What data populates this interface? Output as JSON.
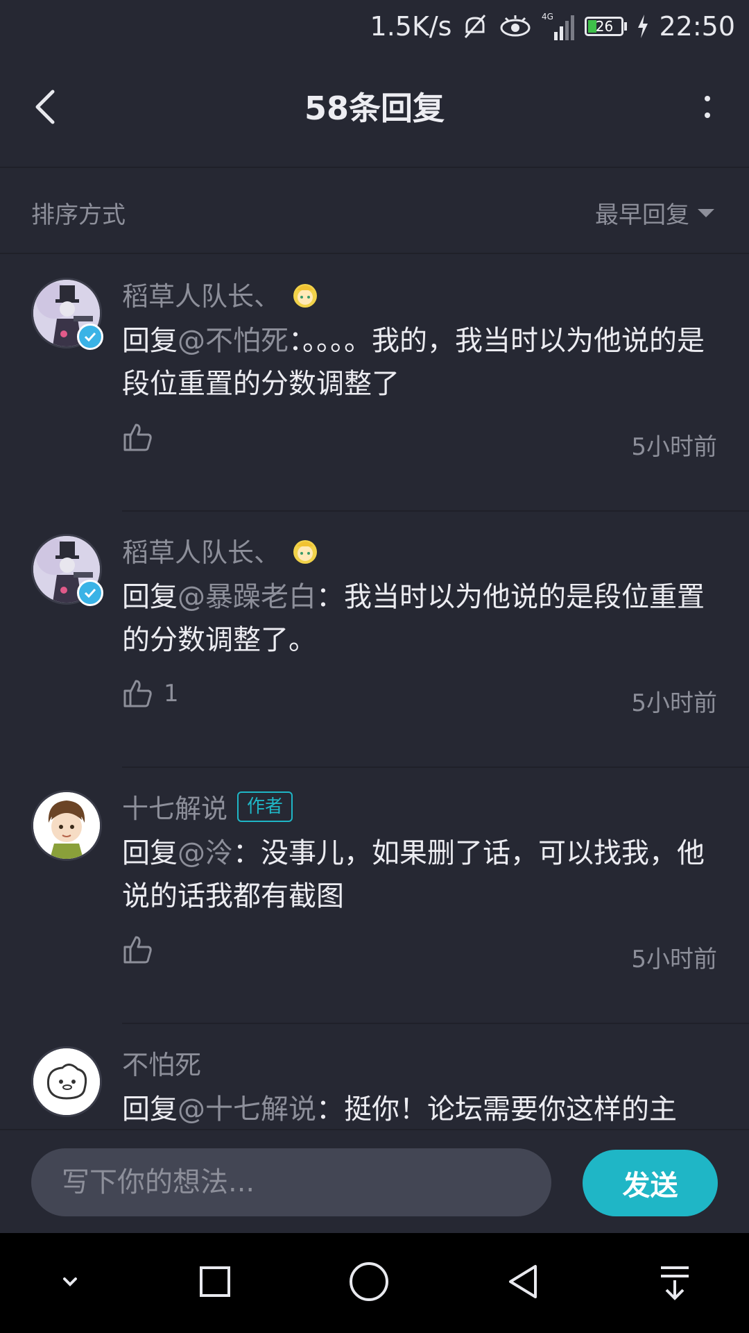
{
  "status_bar": {
    "speed": "1.5K/s",
    "network": "4G",
    "battery": "26",
    "time": "22:50"
  },
  "header": {
    "title": "58条回复"
  },
  "sort": {
    "label": "排序方式",
    "selected": "最早回复"
  },
  "replies": [
    {
      "username": "稻草人队长、",
      "verified": true,
      "author_tag": "",
      "prefix": "回复",
      "mention": "@不怕死",
      "text": "：。。。。我的，我当时以为他说的是段位重置的分数调整了",
      "likes": "",
      "time": "5小时前"
    },
    {
      "username": "稻草人队长、",
      "verified": true,
      "author_tag": "",
      "prefix": "回复",
      "mention": "@暴躁老白",
      "text": "：我当时以为他说的是段位重置的分数调整了。",
      "likes": "1",
      "time": "5小时前"
    },
    {
      "username": "十七解说",
      "verified": false,
      "author_tag": "作者",
      "prefix": "回复",
      "mention": "@泠",
      "text": "：没事儿，如果删了话，可以找我，他说的话我都有截图",
      "likes": "",
      "time": "5小时前"
    },
    {
      "username": "不怕死",
      "verified": false,
      "author_tag": "",
      "prefix": "回复",
      "mention": "@十七解说",
      "text": "：挺你！论坛需要你这样的主",
      "likes": "",
      "time": ""
    }
  ],
  "composer": {
    "placeholder": "写下你的想法...",
    "send_label": "发送"
  },
  "colors": {
    "background": "#262833",
    "accent": "#1fb6c6",
    "muted": "#8d8f9a"
  },
  "icons": [
    "back-arrow-icon",
    "more-vertical-icon",
    "thumbs-up-icon",
    "verified-badge-icon",
    "medal-icon",
    "eye-icon",
    "mute-icon",
    "signal-icon",
    "battery-icon",
    "charging-icon",
    "nav-down-icon",
    "nav-recents-icon",
    "nav-home-icon",
    "nav-back-icon",
    "nav-pull-down-icon"
  ]
}
